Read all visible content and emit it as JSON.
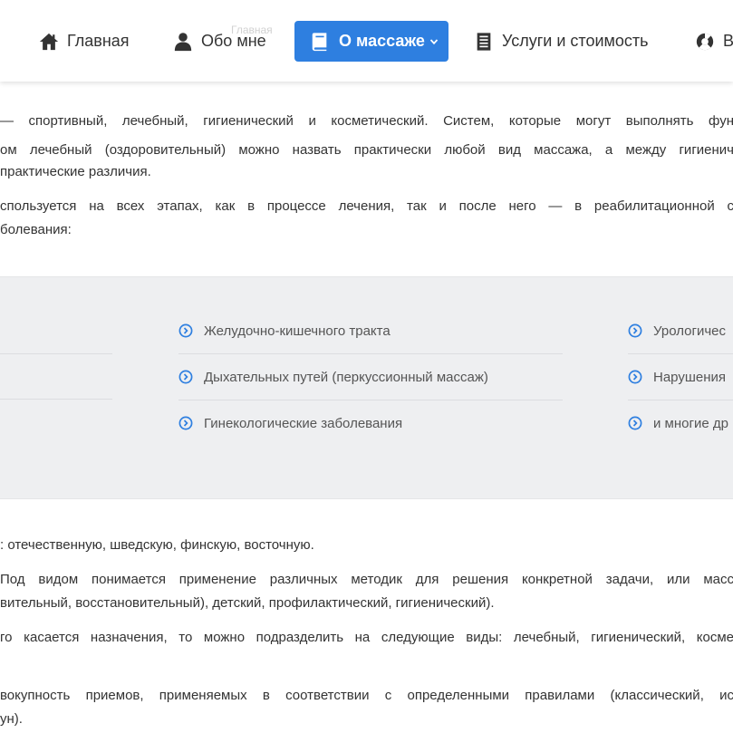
{
  "header": {
    "breadcrumb": "Главная",
    "nav": [
      {
        "label": "Главная",
        "icon": "home-icon"
      },
      {
        "label": "Обо мне",
        "icon": "user-icon"
      },
      {
        "label": "О массаже",
        "icon": "book-icon",
        "active": true
      },
      {
        "label": "Услуги и стоимость",
        "icon": "document-icon"
      },
      {
        "label": "В",
        "icon": "lifebuoy-icon"
      }
    ]
  },
  "intro": {
    "p1": [
      "— спортивный, лечебный, гигиенический и косметический. Систем, которые могут выполнять фун",
      "ом лечебный (оздоровительный) можно назвать практически любой вид массажа, а между гигиенич",
      "практические различия."
    ],
    "p2": [
      "спользуется на всех этапах, как в процессе лечения, так и после него — в реабилитационной с",
      "болевания:"
    ]
  },
  "conditions": {
    "col2": [
      "Желудочно-кишечного тракта",
      "Дыхательных путей (перкуссионный массаж)",
      "Гинекологические заболевания"
    ],
    "col3": [
      "Урологичес",
      "Нарушения",
      "и многие др"
    ]
  },
  "body": {
    "p3": ": отечественную, шведскую, финскую, восточную.",
    "p4": [
      "Под видом понимается применение различных методик для решения конкретной задачи, или масс",
      "вительный, восстановительный), детский, профилактический, гигиенический)."
    ],
    "p5": [
      "го касается назначения, то можно подразделить на следующие виды: лечебный, гигиенический, косме"
    ],
    "p6": [
      "вокупность приемов, применяемых в соответствии с определенными правилами (классический, ис",
      "ун)."
    ]
  },
  "colors": {
    "accent": "#2e7fe0",
    "band": "#eeeff1",
    "text": "#333333",
    "bullet": "#2e7fe0"
  }
}
